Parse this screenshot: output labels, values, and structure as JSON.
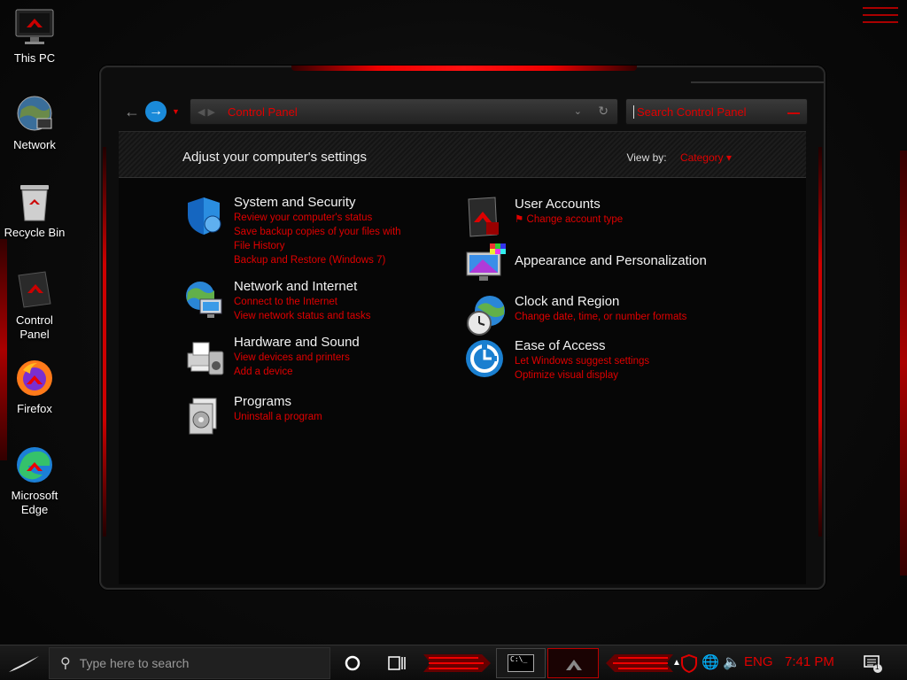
{
  "desktop": {
    "icons": [
      {
        "label": "This PC"
      },
      {
        "label": "Network"
      },
      {
        "label": "Recycle Bin"
      },
      {
        "label": "Control Panel"
      },
      {
        "label": "Firefox"
      },
      {
        "label": "Microsoft Edge"
      }
    ]
  },
  "window": {
    "address_crumb": "Control Panel",
    "search_placeholder": "Search Control Panel",
    "title": "Adjust your computer's settings",
    "view_by_label": "View by:",
    "view_by_value": "Category",
    "categories_left": [
      {
        "title": "System and Security",
        "links": [
          "Review your computer's status",
          "Save backup copies of your files with File History",
          "Backup and Restore (Windows 7)"
        ],
        "icon": "shield-icon"
      },
      {
        "title": "Network and Internet",
        "links": [
          "Connect to the Internet",
          "View network status and tasks"
        ],
        "icon": "network-globe-icon"
      },
      {
        "title": "Hardware and Sound",
        "links": [
          "View devices and printers",
          "Add a device"
        ],
        "icon": "printer-speaker-icon"
      },
      {
        "title": "Programs",
        "links": [
          "Uninstall a program"
        ],
        "icon": "programs-icon"
      }
    ],
    "categories_right": [
      {
        "title": "User Accounts",
        "links": [
          "Change account type"
        ],
        "icon": "user-accounts-icon"
      },
      {
        "title": "Appearance and Personalization",
        "links": [],
        "icon": "monitor-palette-icon"
      },
      {
        "title": "Clock and Region",
        "links": [
          "Change date, time, or number formats"
        ],
        "icon": "clock-globe-icon"
      },
      {
        "title": "Ease of Access",
        "links": [
          "Let Windows suggest settings",
          "Optimize visual display"
        ],
        "icon": "ease-of-access-icon"
      }
    ]
  },
  "taskbar": {
    "search_placeholder": "Type here to search",
    "terminal_label": "C:\\_",
    "language": "ENG",
    "time": "7:41 PM",
    "notification_count": "1"
  },
  "colors": {
    "accent_red": "#e00000",
    "link_blue": "#1a8ad9"
  }
}
